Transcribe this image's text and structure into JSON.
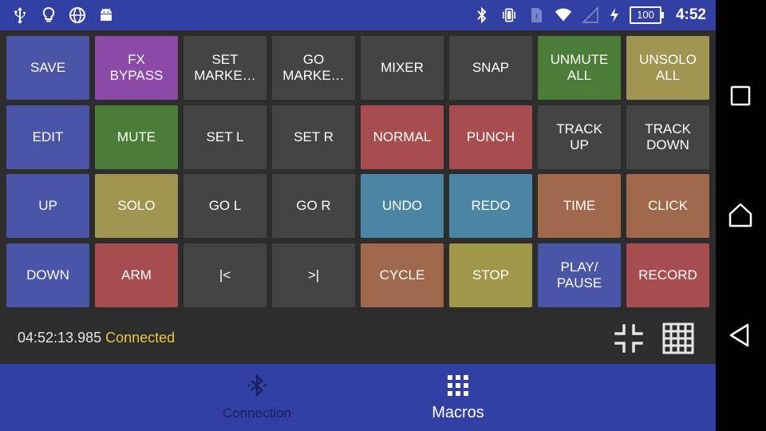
{
  "statusbar": {
    "left_icons": [
      "usb-icon",
      "lightbulb-icon",
      "globe-icon",
      "android-icon"
    ],
    "right_icons": [
      "bluetooth-icon",
      "vibrate-icon",
      "sim-icon",
      "wifi-icon",
      "signal-icon",
      "charging-icon"
    ],
    "battery": "100",
    "clock": "4:52",
    "color": "#3340a3"
  },
  "buttons": [
    {
      "label": "SAVE",
      "color": "#4a55a5"
    },
    {
      "label": "FX\nBYPASS",
      "color": "#8b4aa8"
    },
    {
      "label": "SET\nMARKE…",
      "color": "#444444"
    },
    {
      "label": "GO\nMARKE…",
      "color": "#444444"
    },
    {
      "label": "MIXER",
      "color": "#444444"
    },
    {
      "label": "SNAP",
      "color": "#444444"
    },
    {
      "label": "UNMUTE\nALL",
      "color": "#4b7d38"
    },
    {
      "label": "UNSOLO\nALL",
      "color": "#9f9450"
    },
    {
      "label": "EDIT",
      "color": "#4a55a5"
    },
    {
      "label": "MUTE",
      "color": "#4b7d38"
    },
    {
      "label": "SET L",
      "color": "#444444"
    },
    {
      "label": "SET R",
      "color": "#444444"
    },
    {
      "label": "NORMAL",
      "color": "#a84d4f"
    },
    {
      "label": "PUNCH",
      "color": "#a84d4f"
    },
    {
      "label": "TRACK\nUP",
      "color": "#444444"
    },
    {
      "label": "TRACK\nDOWN",
      "color": "#444444"
    },
    {
      "label": "UP",
      "color": "#4a55a5"
    },
    {
      "label": "SOLO",
      "color": "#9f9450"
    },
    {
      "label": "GO L",
      "color": "#444444"
    },
    {
      "label": "GO R",
      "color": "#444444"
    },
    {
      "label": "UNDO",
      "color": "#4a86a4"
    },
    {
      "label": "REDO",
      "color": "#4a86a4"
    },
    {
      "label": "TIME",
      "color": "#a0684a"
    },
    {
      "label": "CLICK",
      "color": "#a0684a"
    },
    {
      "label": "DOWN",
      "color": "#4a55a5"
    },
    {
      "label": "ARM",
      "color": "#a84d4f"
    },
    {
      "label": "|<",
      "color": "#444444"
    },
    {
      "label": ">|",
      "color": "#444444"
    },
    {
      "label": "CYCLE",
      "color": "#a0684a"
    },
    {
      "label": "STOP",
      "color": "#a09647"
    },
    {
      "label": "PLAY/\nPAUSE",
      "color": "#4a55a5"
    },
    {
      "label": "RECORD",
      "color": "#a84d4f"
    }
  ],
  "info": {
    "time": "04:52:13.985",
    "status": "Connected",
    "status_color": "#e5c748",
    "icons": [
      "collapse-icon",
      "grid-icon"
    ]
  },
  "nav": {
    "connection_label": "Connection",
    "macros_label": "Macros",
    "active": "Macros"
  },
  "system_nav": [
    "recent-apps-icon",
    "home-icon",
    "back-icon"
  ]
}
